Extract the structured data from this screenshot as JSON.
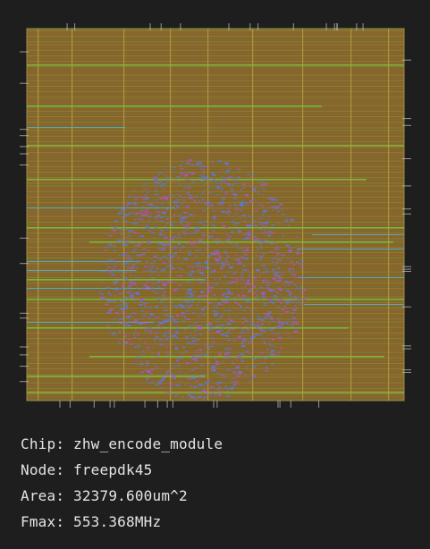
{
  "layout": {
    "colors": {
      "background": "#1e1e1e",
      "die": "#7a6a2c",
      "die_border": "#9c9046",
      "row_red": "#b25a34",
      "row_orange": "#b07a36",
      "metal_green": "#79c23c",
      "via_blue": "#5b7ad6",
      "via_purple": "#b052c8",
      "metal_cyan": "#4fb0c8",
      "pin_light": "#c8c8c8"
    }
  },
  "info": {
    "chip_label": "Chip:",
    "chip_value": "zhw_encode_module",
    "node_label": "Node:",
    "node_value": "freepdk45",
    "area_label": "Area:",
    "area_value": "32379.600um^2",
    "fmax_label": "Fmax:",
    "fmax_value": "553.368MHz"
  }
}
